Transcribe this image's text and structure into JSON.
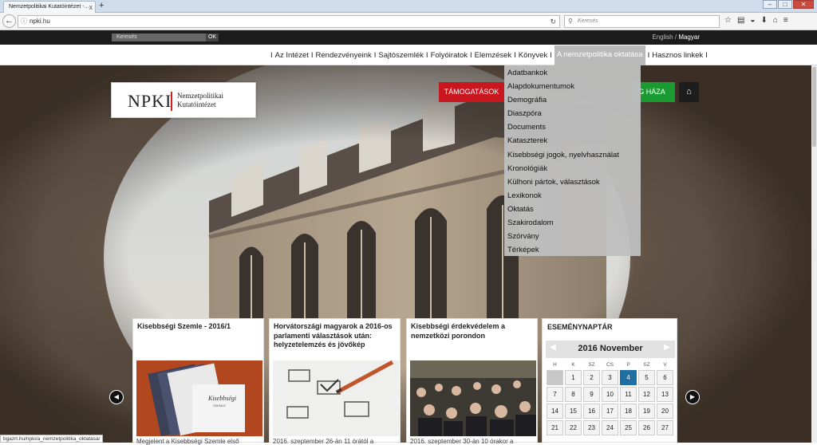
{
  "browser": {
    "tab_title": "Nemzetpolitikai Kutatóintézet -...",
    "tab_close": "x",
    "new_tab": "+",
    "url": "npki.hu",
    "search_placeholder": "Keresés",
    "status_url": "bgazrt.hu/npki/a_nemzetpolitika_oktatasa/"
  },
  "topbar": {
    "search_placeholder": "Keresés",
    "search_button": "OK",
    "lang_english": "English",
    "lang_sep": "/",
    "lang_magyar": "Magyar"
  },
  "menu": {
    "items": [
      "Az Intézet",
      "Rendezvényeink",
      "Sajtószemlék",
      "Folyóiratok",
      "Elemzések",
      "Könyvek",
      "A nemzetpolitika oktatása",
      "Hasznos linkek"
    ],
    "active_index": 6
  },
  "logo": {
    "abbr": "NPKI",
    "line1": "Nemzetpolitikai",
    "line2": "Kutatóintézet"
  },
  "buttons": {
    "tamogatasok": "TÁMOGATÁSOK",
    "green": "G HÁZA"
  },
  "dropdown": {
    "items": [
      "Adatbankok",
      "Alapdokumentumok",
      "Demográfia",
      "Diaszpóra",
      "Documents",
      "Kataszterek",
      "Kisebbségi jogok, nyelvhasználat",
      "Kronológiák",
      "Külhoni pártok, választások",
      "Lexikonok",
      "Oktatás",
      "Szakirodalom",
      "Szórvány",
      "Térképek"
    ]
  },
  "cards": [
    {
      "title": "Kisebbségi Szemle - 2016/1",
      "text": "Megjelent a Kisebbségi Szemle első"
    },
    {
      "title": "Horvátországi magyarok a 2016-os parlamenti választások után: helyzetelemzés és jövőkép",
      "text": "2016. szeptember 26-án 11 órától a"
    },
    {
      "title": "Kisebbségi érdekvédelem a nemzetközi porondon",
      "text": "2016. szeptember 30-án 10 órakor a"
    }
  ],
  "card_image_text": {
    "magazine_title": "Kisebbségi",
    "magazine_sub": "SZEMLE"
  },
  "calendar": {
    "title": "ESEMÉNYNAPTÁR",
    "month": "2016 November",
    "prev": "◀",
    "next": "▶",
    "day_headers": [
      "H",
      "K",
      "SZ",
      "CS",
      "P",
      "SZ",
      "V"
    ],
    "weeks": [
      [
        "",
        "1",
        "2",
        "3",
        "4",
        "5",
        "6"
      ],
      [
        "7",
        "8",
        "9",
        "10",
        "11",
        "12",
        "13"
      ],
      [
        "14",
        "15",
        "16",
        "17",
        "18",
        "19",
        "20"
      ],
      [
        "21",
        "22",
        "23",
        "24",
        "25",
        "26",
        "27"
      ]
    ],
    "today": "4"
  },
  "colors": {
    "tamogatasok_bg": "#c8171e",
    "green_bg": "#1a9b32",
    "calendar_today": "#1f6fa2"
  }
}
